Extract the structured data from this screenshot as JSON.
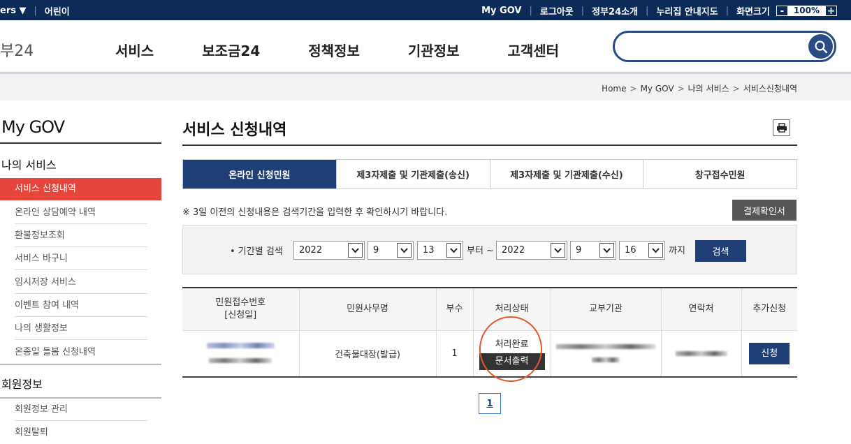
{
  "topbar": {
    "left_items": [
      "ers ▼",
      "어린이"
    ],
    "right_items": [
      "My GOV",
      "로그아웃",
      "정부24소개",
      "누리집 안내지도"
    ],
    "zoom_label": "화면크기",
    "zoom_minus": "-",
    "zoom_value": "100%",
    "zoom_plus": "+"
  },
  "header": {
    "logo": "부24",
    "nav": [
      "서비스",
      "보조금24",
      "정책정보",
      "기관정보",
      "고객센터"
    ],
    "search_placeholder": ""
  },
  "breadcrumb": [
    "Home",
    "My GOV",
    "나의 서비스",
    "서비스신청내역"
  ],
  "sidebar": {
    "title": "My GOV",
    "group1": "나의 서비스",
    "items1": [
      "서비스 신청내역",
      "온라인 상담예약 내역",
      "환불정보조회",
      "서비스 바구니",
      "임시저장 서비스",
      "이벤트 참여 내역",
      "나의 생활정보",
      "온종일 돌봄 신청내역"
    ],
    "group2": "회원정보",
    "items2": [
      "회원정보 관리",
      "회원탈퇴"
    ]
  },
  "main": {
    "title": "서비스 신청내역",
    "tabs": [
      "온라인 신청민원",
      "제3자제출 및 기관제출(송신)",
      "제3자제출 및 기관제출(수신)",
      "창구접수민원"
    ],
    "notice": "※ 3일 이전의 신청내용은 검색기간을 입력한 후 확인하시기 바랍니다.",
    "payment_button": "결제확인서",
    "filter": {
      "label": "• 기간별 검색",
      "from_year": "2022",
      "from_month": "9",
      "from_day": "13",
      "from_suffix": "부터 ~",
      "to_year": "2022",
      "to_month": "9",
      "to_day": "16",
      "to_suffix": "까지",
      "search_button": "검색"
    },
    "table": {
      "headers": [
        "민원접수번호\n[신청일]",
        "민원사무명",
        "부수",
        "처리상태",
        "교부기관",
        "연락처",
        "추가신청"
      ],
      "header_line1": "민원접수번호",
      "header_line2": "[신청일]",
      "rows": [
        {
          "service": "건축물대장(발급)",
          "count": "1",
          "status": "처리완료",
          "print_button": "문서출력",
          "add_button": "신청"
        }
      ]
    },
    "pagination": [
      "1"
    ]
  }
}
